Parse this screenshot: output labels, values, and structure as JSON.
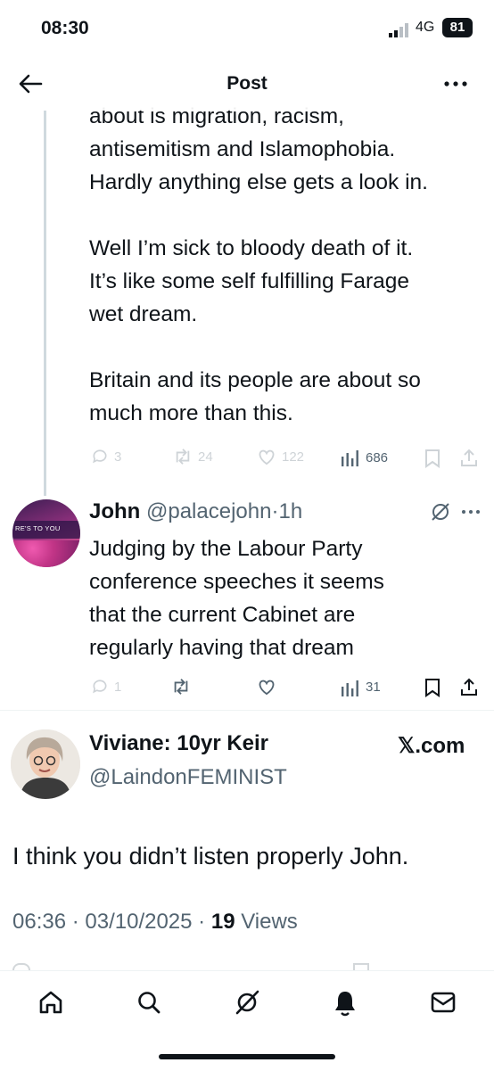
{
  "status": {
    "time": "08:30",
    "network": "4G",
    "battery": "81"
  },
  "header": {
    "title": "Post"
  },
  "parent_post": {
    "text": "about is migration, racism,\nantisemitism and Islamophobia.\nHardly anything else gets a look in.\n\nWell I’m sick to bloody death of it.\nIt’s like some self fulfilling Farage\nwet dream.\n\nBritain and its people are about so\nmuch more than this.",
    "replies": "3",
    "reposts": "24",
    "likes": "122",
    "views": "686"
  },
  "reply_post": {
    "name": "John",
    "handle": "@palacejohn",
    "time": "1h",
    "banner_text": "RE'S TO YOU",
    "text": "Judging by the Labour Party\nconference speeches it seems\nthat the current Cabinet are\nregularly having that dream",
    "replies": "1",
    "views": "31"
  },
  "main_post": {
    "name": "Viviane: 10yr Keir",
    "handle": "@LaindonFEMINIST",
    "source": "𝕏.com",
    "text": "I think you didn’t listen properly John.",
    "timestamp": "06:36 · 03/10/2025 · ",
    "views_count": "19",
    "views_label": " Views"
  },
  "icons": [
    "back-arrow-icon",
    "more-icon",
    "reply-icon",
    "repost-icon",
    "like-icon",
    "views-icon",
    "bookmark-icon",
    "share-icon",
    "grok-icon",
    "home-icon",
    "search-icon",
    "notifications-icon",
    "messages-icon"
  ],
  "colors": {
    "text": "#0f1419",
    "muted": "#536471",
    "thread": "#cfd9de"
  }
}
